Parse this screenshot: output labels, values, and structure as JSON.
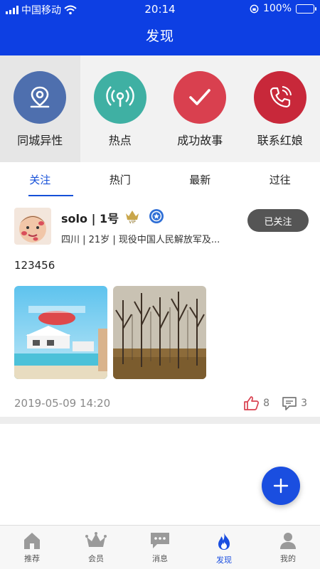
{
  "status": {
    "carrier": "中国移动",
    "time": "20:14",
    "battery": "100%",
    "battery_level": 1.0
  },
  "header": {
    "title": "发现"
  },
  "categories": [
    {
      "label": "同城异性",
      "icon": "location-pin-icon",
      "color": "#4e6fae"
    },
    {
      "label": "热点",
      "icon": "broadcast-icon",
      "color": "#3fb0a3"
    },
    {
      "label": "成功故事",
      "icon": "checkmark-icon",
      "color": "#d9404f"
    },
    {
      "label": "联系红娘",
      "icon": "phone-icon",
      "color": "#c8283a"
    }
  ],
  "tabs": [
    {
      "label": "关注",
      "active": true
    },
    {
      "label": "热门",
      "active": false
    },
    {
      "label": "最新",
      "active": false
    },
    {
      "label": "过往",
      "active": false
    }
  ],
  "post": {
    "username": "solo | 1号",
    "vip_badge": "VIP",
    "info": "四川 | 21岁 | 现役中国人民解放军及...",
    "follow_label": "已关注",
    "content": "123456",
    "time": "2019-05-09 14:20",
    "likes": "8",
    "comments": "3"
  },
  "colors": {
    "primary": "#0d3fe3",
    "accent": "#1a4ee0",
    "like": "#d9404f"
  },
  "nav": [
    {
      "label": "推荐",
      "icon": "home-icon",
      "active": false
    },
    {
      "label": "会员",
      "icon": "crown-icon",
      "active": false
    },
    {
      "label": "消息",
      "icon": "message-icon",
      "active": false
    },
    {
      "label": "发现",
      "icon": "flame-icon",
      "active": true
    },
    {
      "label": "我的",
      "icon": "person-icon",
      "active": false
    }
  ]
}
